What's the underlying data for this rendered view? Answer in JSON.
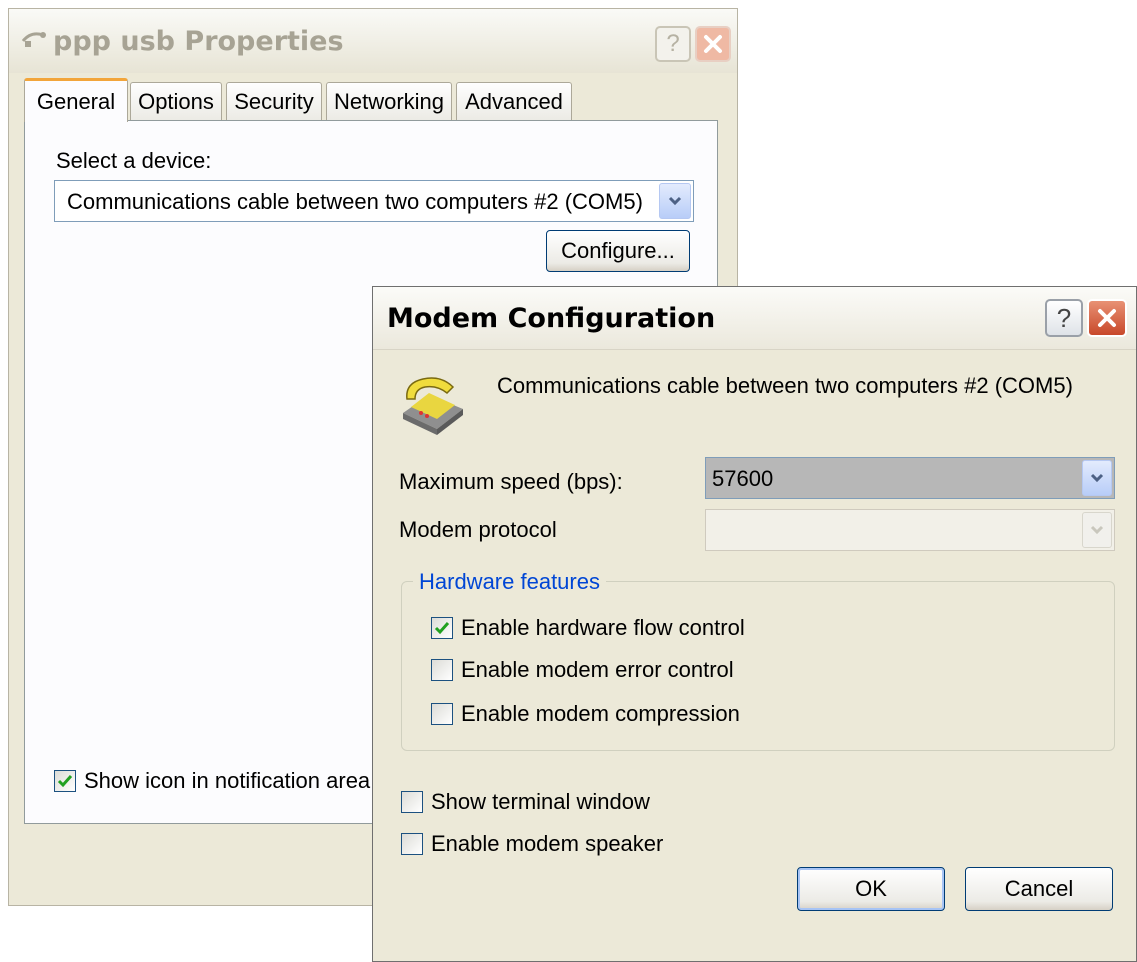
{
  "properties_window": {
    "title": "ppp usb Properties",
    "help_glyph": "?",
    "tabs": [
      {
        "label": "General",
        "active": true
      },
      {
        "label": "Options",
        "active": false
      },
      {
        "label": "Security",
        "active": false
      },
      {
        "label": "Networking",
        "active": false
      },
      {
        "label": "Advanced",
        "active": false
      }
    ],
    "select_device_label": "Select a device:",
    "device_value": "Communications cable between two computers #2 (COM5)",
    "configure_label": "Configure...",
    "show_icon_label": "Show icon in notification area",
    "show_icon_checked": true
  },
  "modem_dialog": {
    "title": "Modem Configuration",
    "help_glyph": "?",
    "device_name": "Communications cable between two computers #2 (COM5)",
    "max_speed_label": "Maximum speed (bps):",
    "max_speed_value": "57600",
    "modem_protocol_label": "Modem protocol",
    "modem_protocol_value": "",
    "hardware_features": {
      "legend": "Hardware features",
      "options": [
        {
          "label": "Enable hardware flow control",
          "checked": true
        },
        {
          "label": "Enable modem error control",
          "checked": false
        },
        {
          "label": "Enable modem compression",
          "checked": false
        }
      ]
    },
    "show_terminal_label": "Show terminal window",
    "show_terminal_checked": false,
    "modem_speaker_label": "Enable modem speaker",
    "modem_speaker_checked": false,
    "ok_label": "OK",
    "cancel_label": "Cancel"
  },
  "colors": {
    "dialog_bg": "#ece9d8",
    "group_legend": "#0046d5",
    "active_tab_accent": "#f2a53a",
    "close_button": "#c8482a",
    "checkmark": "#21a121"
  },
  "icons": [
    "phone-connection-icon",
    "dialup-connection-icon",
    "help-icon",
    "close-icon",
    "chevron-down-icon",
    "checkmark-icon"
  ]
}
